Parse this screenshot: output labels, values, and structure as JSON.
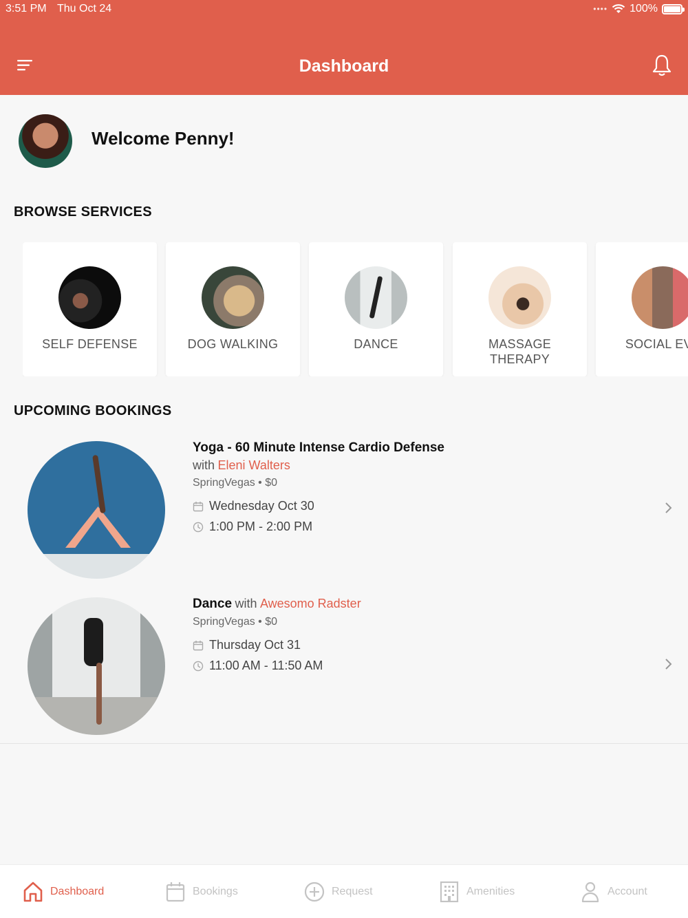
{
  "status_bar": {
    "time": "3:51 PM",
    "date": "Thu Oct 24",
    "battery": "100%"
  },
  "header": {
    "title": "Dashboard"
  },
  "welcome": {
    "text": "Welcome Penny!"
  },
  "browse": {
    "title": "BROWSE SERVICES",
    "services": [
      {
        "label": "SELF DEFENSE"
      },
      {
        "label": "DOG WALKING"
      },
      {
        "label": "DANCE"
      },
      {
        "label": "MASSAGE\nTHERAPY"
      },
      {
        "label": "SOCIAL EVE"
      }
    ]
  },
  "upcoming": {
    "title": "UPCOMING BOOKINGS",
    "bookings": [
      {
        "title": "Yoga - 60 Minute Intense Cardio Defense",
        "with": "with",
        "instructor": "Eleni Walters",
        "location": "SpringVegas • $0",
        "date": "Wednesday Oct 30",
        "time": "1:00 PM - 2:00 PM"
      },
      {
        "title": "Dance",
        "with": "with",
        "instructor": "Awesomo Radster",
        "location": "SpringVegas • $0",
        "date": "Thursday Oct 31",
        "time": "11:00 AM - 11:50 AM"
      }
    ]
  },
  "tabs": [
    {
      "label": "Dashboard",
      "icon": "home-icon",
      "active": true
    },
    {
      "label": "Bookings",
      "icon": "calendar-icon",
      "active": false
    },
    {
      "label": "Request",
      "icon": "plus-circle-icon",
      "active": false
    },
    {
      "label": "Amenities",
      "icon": "building-icon",
      "active": false
    },
    {
      "label": "Account",
      "icon": "person-icon",
      "active": false
    }
  ],
  "colors": {
    "brand": "#e05f4c",
    "inactive": "#c3c3c3"
  }
}
